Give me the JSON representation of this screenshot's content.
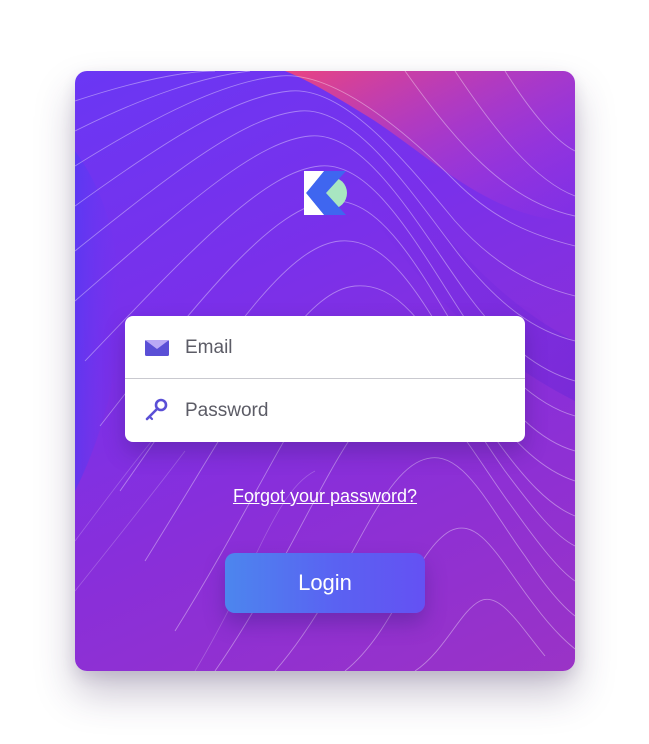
{
  "colors": {
    "card_gradient_start": "#6a37f4",
    "card_gradient_end": "#9a33c6",
    "accent_pink": "#f0457a",
    "logo_blue": "#3f66f0",
    "logo_mint": "#a8e6c1",
    "field_icon": "#5a4fd6",
    "button_gradient_start": "#4c86ee",
    "button_gradient_end": "#6451f3"
  },
  "logo": {
    "icon": "k-logo-icon"
  },
  "login_form": {
    "email": {
      "icon": "envelope-icon",
      "placeholder": "Email",
      "value": ""
    },
    "password": {
      "icon": "key-icon",
      "placeholder": "Password",
      "value": ""
    }
  },
  "forgot_link": "Forgot your password?",
  "login_button": "Login"
}
